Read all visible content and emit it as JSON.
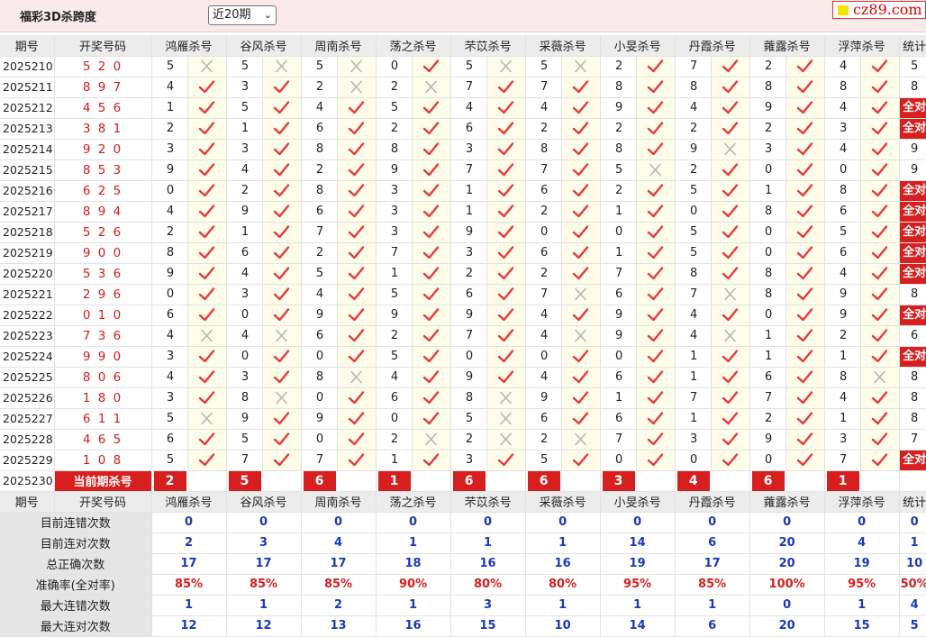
{
  "page_title": "福彩3D杀跨度",
  "period_select": "近20期",
  "logo_text": "cz89.com",
  "headers": [
    "期号",
    "开奖号码",
    "鸿雁杀号",
    "谷风杀号",
    "周南杀号",
    "荡之杀号",
    "芣苡杀号",
    "采薇杀号",
    "小旻杀号",
    "丹霞杀号",
    "蕹露杀号",
    "浮萍杀号",
    "统计"
  ],
  "all_correct_label": "全对",
  "rows": [
    {
      "issue": "2025210",
      "code": "5 2 0",
      "k": [
        5,
        5,
        5,
        0,
        5,
        5,
        2,
        7,
        2,
        4
      ],
      "r": [
        0,
        0,
        0,
        1,
        0,
        0,
        1,
        1,
        1,
        1
      ],
      "stat": "5"
    },
    {
      "issue": "2025211",
      "code": "8 9 7",
      "k": [
        4,
        3,
        2,
        2,
        7,
        7,
        8,
        8,
        8,
        8
      ],
      "r": [
        1,
        1,
        0,
        0,
        1,
        1,
        1,
        1,
        1,
        1
      ],
      "stat": "8"
    },
    {
      "issue": "2025212",
      "code": "4 5 6",
      "k": [
        1,
        5,
        4,
        5,
        4,
        4,
        9,
        4,
        9,
        4
      ],
      "r": [
        1,
        1,
        1,
        1,
        1,
        1,
        1,
        1,
        1,
        1
      ],
      "stat": "全对"
    },
    {
      "issue": "2025213",
      "code": "3 8 1",
      "k": [
        2,
        1,
        6,
        2,
        6,
        2,
        2,
        2,
        2,
        3
      ],
      "r": [
        1,
        1,
        1,
        1,
        1,
        1,
        1,
        1,
        1,
        1
      ],
      "stat": "全对"
    },
    {
      "issue": "2025214",
      "code": "9 2 0",
      "k": [
        3,
        3,
        8,
        8,
        3,
        8,
        8,
        9,
        3,
        4
      ],
      "r": [
        1,
        1,
        1,
        1,
        1,
        1,
        1,
        0,
        1,
        1
      ],
      "stat": "9"
    },
    {
      "issue": "2025215",
      "code": "8 5 3",
      "k": [
        9,
        4,
        2,
        9,
        7,
        7,
        5,
        2,
        0,
        0
      ],
      "r": [
        1,
        1,
        1,
        1,
        1,
        1,
        0,
        1,
        1,
        1
      ],
      "stat": "9"
    },
    {
      "issue": "2025216",
      "code": "6 2 5",
      "k": [
        0,
        2,
        8,
        3,
        1,
        6,
        2,
        5,
        1,
        8
      ],
      "r": [
        1,
        1,
        1,
        1,
        1,
        1,
        1,
        1,
        1,
        1
      ],
      "stat": "全对"
    },
    {
      "issue": "2025217",
      "code": "8 9 4",
      "k": [
        4,
        9,
        6,
        3,
        1,
        2,
        1,
        0,
        8,
        6
      ],
      "r": [
        1,
        1,
        1,
        1,
        1,
        1,
        1,
        1,
        1,
        1
      ],
      "stat": "全对"
    },
    {
      "issue": "2025218",
      "code": "5 2 6",
      "k": [
        2,
        1,
        7,
        3,
        9,
        0,
        0,
        5,
        0,
        5
      ],
      "r": [
        1,
        1,
        1,
        1,
        1,
        1,
        1,
        1,
        1,
        1
      ],
      "stat": "全对"
    },
    {
      "issue": "2025219",
      "code": "9 0 0",
      "k": [
        8,
        6,
        2,
        7,
        3,
        6,
        1,
        5,
        0,
        6
      ],
      "r": [
        1,
        1,
        1,
        1,
        1,
        1,
        1,
        1,
        1,
        1
      ],
      "stat": "全对"
    },
    {
      "issue": "2025220",
      "code": "5 3 6",
      "k": [
        9,
        4,
        5,
        1,
        2,
        2,
        7,
        8,
        8,
        4
      ],
      "r": [
        1,
        1,
        1,
        1,
        1,
        1,
        1,
        1,
        1,
        1
      ],
      "stat": "全对"
    },
    {
      "issue": "2025221",
      "code": "2 9 6",
      "k": [
        0,
        3,
        4,
        5,
        6,
        7,
        6,
        7,
        8,
        9
      ],
      "r": [
        1,
        1,
        1,
        1,
        1,
        0,
        1,
        0,
        1,
        1
      ],
      "stat": "8"
    },
    {
      "issue": "2025222",
      "code": "0 1 0",
      "k": [
        6,
        0,
        9,
        9,
        9,
        4,
        9,
        4,
        0,
        9
      ],
      "r": [
        1,
        1,
        1,
        1,
        1,
        1,
        1,
        1,
        1,
        1
      ],
      "stat": "全对"
    },
    {
      "issue": "2025223",
      "code": "7 3 6",
      "k": [
        4,
        4,
        6,
        2,
        7,
        4,
        9,
        4,
        1,
        2
      ],
      "r": [
        0,
        0,
        1,
        1,
        1,
        0,
        1,
        0,
        1,
        1
      ],
      "stat": "6"
    },
    {
      "issue": "2025224",
      "code": "9 9 0",
      "k": [
        3,
        0,
        0,
        5,
        0,
        0,
        0,
        1,
        1,
        1
      ],
      "r": [
        1,
        1,
        1,
        1,
        1,
        1,
        1,
        1,
        1,
        1
      ],
      "stat": "全对"
    },
    {
      "issue": "2025225",
      "code": "8 0 6",
      "k": [
        4,
        3,
        8,
        4,
        9,
        4,
        6,
        1,
        6,
        8
      ],
      "r": [
        1,
        1,
        0,
        1,
        1,
        1,
        1,
        1,
        1,
        0
      ],
      "stat": "8"
    },
    {
      "issue": "2025226",
      "code": "1 8 0",
      "k": [
        3,
        8,
        0,
        6,
        8,
        9,
        1,
        7,
        7,
        4
      ],
      "r": [
        1,
        0,
        1,
        1,
        0,
        1,
        1,
        1,
        1,
        1
      ],
      "stat": "8"
    },
    {
      "issue": "2025227",
      "code": "6 1 1",
      "k": [
        5,
        9,
        9,
        0,
        5,
        6,
        6,
        1,
        2,
        1
      ],
      "r": [
        0,
        1,
        1,
        1,
        0,
        1,
        1,
        1,
        1,
        1
      ],
      "stat": "8"
    },
    {
      "issue": "2025228",
      "code": "4 6 5",
      "k": [
        6,
        5,
        0,
        2,
        2,
        2,
        7,
        3,
        9,
        3
      ],
      "r": [
        1,
        1,
        1,
        0,
        0,
        0,
        1,
        1,
        1,
        1
      ],
      "stat": "7"
    },
    {
      "issue": "2025229",
      "code": "1 0 8",
      "k": [
        5,
        7,
        7,
        1,
        3,
        5,
        0,
        0,
        0,
        7
      ],
      "r": [
        1,
        1,
        1,
        1,
        1,
        1,
        1,
        1,
        1,
        1
      ],
      "stat": "全对"
    }
  ],
  "current": {
    "issue": "2025230",
    "label": "当前期杀号",
    "k": [
      2,
      5,
      6,
      1,
      6,
      6,
      3,
      4,
      6,
      1
    ]
  },
  "stats": [
    {
      "label": "目前连错次数",
      "v": [
        "0",
        "0",
        "0",
        "0",
        "0",
        "0",
        "0",
        "0",
        "0",
        "0",
        "0"
      ],
      "style": "sv"
    },
    {
      "label": "目前连对次数",
      "v": [
        "2",
        "3",
        "4",
        "1",
        "1",
        "1",
        "14",
        "6",
        "20",
        "4",
        "1"
      ],
      "style": "sv"
    },
    {
      "label": "总正确次数",
      "v": [
        "17",
        "17",
        "17",
        "18",
        "16",
        "16",
        "19",
        "17",
        "20",
        "19",
        "10"
      ],
      "style": "sv"
    },
    {
      "label": "准确率(全对率)",
      "v": [
        "85%",
        "85%",
        "85%",
        "90%",
        "80%",
        "80%",
        "95%",
        "85%",
        "100%",
        "95%",
        "50%"
      ],
      "style": "sr"
    },
    {
      "label": "最大连错次数",
      "v": [
        "1",
        "1",
        "2",
        "1",
        "3",
        "1",
        "1",
        "1",
        "0",
        "1",
        "4"
      ],
      "style": "sv"
    },
    {
      "label": "最大连对次数",
      "v": [
        "12",
        "12",
        "13",
        "16",
        "15",
        "10",
        "14",
        "6",
        "20",
        "15",
        "5"
      ],
      "style": "sv"
    }
  ]
}
